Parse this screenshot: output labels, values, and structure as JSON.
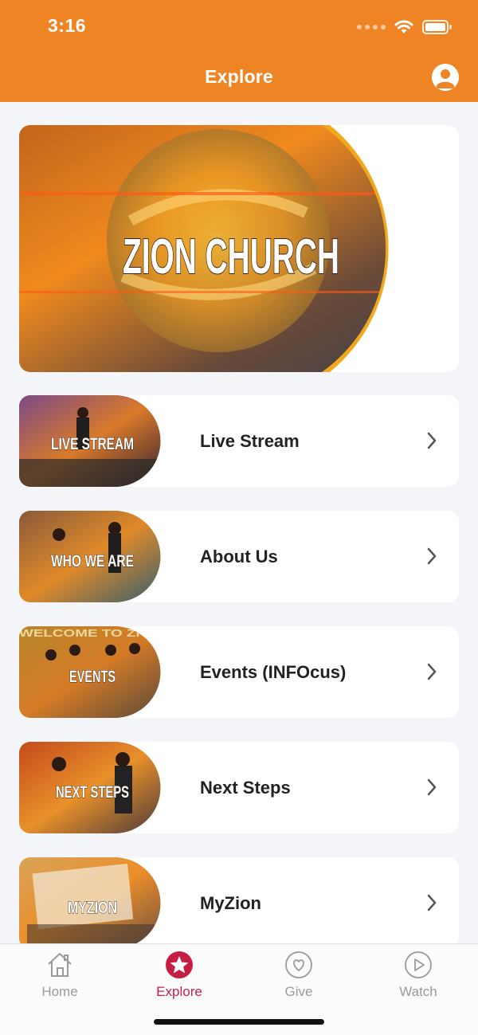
{
  "status_bar": {
    "time": "3:16"
  },
  "header": {
    "title": "Explore"
  },
  "hero": {
    "text": "ZION CHURCH"
  },
  "items": [
    {
      "label": "Live Stream",
      "thumb_text": "LIVE STREAM"
    },
    {
      "label": "About Us",
      "thumb_text": "WHO WE ARE"
    },
    {
      "label": "Events (INFOcus)",
      "thumb_text": "EVENTS",
      "thumb_banner": "WELCOME TO ZION"
    },
    {
      "label": "Next Steps",
      "thumb_text": "NEXT STEPS"
    },
    {
      "label": "MyZion",
      "thumb_text": "MYZION"
    }
  ],
  "tabs": [
    {
      "label": "Home",
      "icon": "home-icon"
    },
    {
      "label": "Explore",
      "icon": "star-icon",
      "active": true
    },
    {
      "label": "Give",
      "icon": "heart-icon"
    },
    {
      "label": "Watch",
      "icon": "play-icon"
    }
  ],
  "colors": {
    "header_orange": "#ef8425",
    "active_tab": "#c41e45",
    "inactive_tab": "#9a9a9a",
    "background": "#f4f5f9"
  }
}
